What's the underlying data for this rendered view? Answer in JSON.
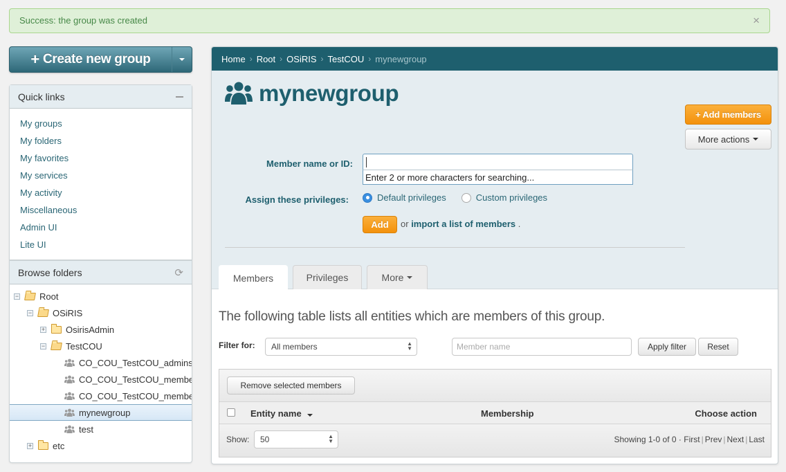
{
  "alert": {
    "message": "Success: the group was created",
    "close_glyph": "×",
    "icon": "close-icon"
  },
  "create_button": {
    "plus": "+",
    "label": "Create new group"
  },
  "quick_links": {
    "title": "Quick links",
    "items": [
      {
        "label": "My groups"
      },
      {
        "label": "My folders"
      },
      {
        "label": "My favorites"
      },
      {
        "label": "My services"
      },
      {
        "label": "My activity"
      },
      {
        "label": "Miscellaneous"
      },
      {
        "label": "Admin UI"
      },
      {
        "label": "Lite UI"
      }
    ]
  },
  "browse_folders": {
    "title": "Browse folders",
    "refresh_glyph": "⟳",
    "tree": [
      {
        "label": "Root",
        "type": "folder-open",
        "depth": 0,
        "toggle": "−"
      },
      {
        "label": "OSiRIS",
        "type": "folder-open",
        "depth": 1,
        "toggle": "−"
      },
      {
        "label": "OsirisAdmin",
        "type": "folder",
        "depth": 2,
        "toggle": "+"
      },
      {
        "label": "TestCOU",
        "type": "folder-open",
        "depth": 2,
        "toggle": "−"
      },
      {
        "label": "CO_COU_TestCOU_admins",
        "type": "group",
        "depth": 3
      },
      {
        "label": "CO_COU_TestCOU_members",
        "type": "group",
        "depth": 3
      },
      {
        "label": "CO_COU_TestCOU_members",
        "type": "group",
        "depth": 3
      },
      {
        "label": "mynewgroup",
        "type": "group",
        "depth": 3,
        "selected": true
      },
      {
        "label": "test",
        "type": "group",
        "depth": 3
      },
      {
        "label": "etc",
        "type": "folder",
        "depth": 1,
        "toggle": "+"
      }
    ]
  },
  "breadcrumb": {
    "items": [
      "Home",
      "Root",
      "OSiRIS",
      "TestCOU"
    ],
    "current": "mynewgroup",
    "separator": "›"
  },
  "group": {
    "title": "mynewgroup",
    "add_members_label": "+ Add members",
    "more_actions_label": "More actions"
  },
  "add_member_form": {
    "member_label": "Member name or ID:",
    "member_value": "",
    "autocomplete_hint": "Enter 2 or more characters for searching...",
    "privileges_label": "Assign these privileges:",
    "privilege_options": [
      {
        "label": "Default privileges",
        "checked": true
      },
      {
        "label": "Custom privileges",
        "checked": false
      }
    ],
    "add_label": "Add",
    "or_text": "or",
    "import_link": "import a list of members",
    "period": "."
  },
  "more_toggle": {
    "label": "More",
    "chevron": "⌄"
  },
  "tabs": [
    {
      "label": "Members",
      "active": true
    },
    {
      "label": "Privileges",
      "active": false
    },
    {
      "label": "More",
      "active": false,
      "dropdown": true
    }
  ],
  "members_section": {
    "lead": "The following table lists all entities which are members of this group.",
    "filter_label": "Filter for:",
    "filter_select_value": "All members",
    "member_name_placeholder": "Member name",
    "apply_filter_label": "Apply filter",
    "reset_label": "Reset",
    "remove_selected_label": "Remove selected members",
    "columns": [
      "Entity name",
      "Membership",
      "Choose action"
    ],
    "rows": [],
    "show_label": "Show:",
    "page_size": "50",
    "showing_text": "Showing 1-0 of 0",
    "dot": "·",
    "pager": [
      "First",
      "Prev",
      "Next",
      "Last"
    ]
  }
}
